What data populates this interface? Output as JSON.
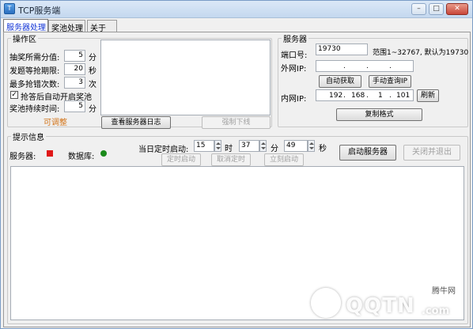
{
  "window": {
    "title": "TCP服务端",
    "controls": [
      "minimize-icon",
      "maximize-icon",
      "close-icon"
    ]
  },
  "tabs": [
    {
      "label": "服务器处理",
      "active": true
    },
    {
      "label": "奖池处理",
      "active": false
    },
    {
      "label": "关于",
      "active": false
    }
  ],
  "operation": {
    "legend": "操作区",
    "min_score_label": "抽奖所需分值:",
    "min_score_value": "5",
    "min_score_unit": "分",
    "buzzer_label": "发题等抢期限:",
    "buzzer_value": "20",
    "buzzer_unit": "秒",
    "max_wrong_label": "最多抢错次数:",
    "max_wrong_value": "3",
    "max_wrong_unit": "次",
    "auto_open_label": "抢答后自动开启奖池",
    "auto_open_checked": true,
    "duration_label": "奖池持续时间:",
    "duration_value": "5",
    "duration_unit": "分",
    "adjustable_label": "可调整",
    "view_log_button": "查看服务器日志",
    "force_offline_button": "强制下线"
  },
  "server": {
    "legend": "服务器",
    "port_label": "端口号:",
    "port_value": "19730",
    "port_hint": "范围1~32767, 默认为19730",
    "external_ip_label": "外网IP:",
    "external_ip": [
      "",
      "",
      "",
      ""
    ],
    "auto_get_button": "自动获取",
    "manual_query_button": "手动查询IP",
    "internal_ip_label": "内网IP:",
    "internal_ip": [
      "192",
      "168",
      "1",
      "101"
    ],
    "refresh_button": "刷新",
    "copy_format_button": "复制格式"
  },
  "info": {
    "legend": "提示信息",
    "server_label": "服务器:",
    "server_status_color": "#e01818",
    "database_label": "数据库:",
    "database_status_color": "#1a8a1a",
    "timer_label": "当日定时启动:",
    "hour_value": "15",
    "hour_unit": "时",
    "minute_value": "37",
    "minute_unit": "分",
    "second_value": "49",
    "second_unit": "秒",
    "timed_start_button": "定时启动",
    "cancel_timer_button": "取消定时",
    "start_now_button": "立刻启动",
    "start_server_button": "启动服务器",
    "close_exit_button": "关闭并退出"
  },
  "watermark": {
    "brand": "QQTN",
    "domain": ".com",
    "badge": "腾牛网"
  }
}
